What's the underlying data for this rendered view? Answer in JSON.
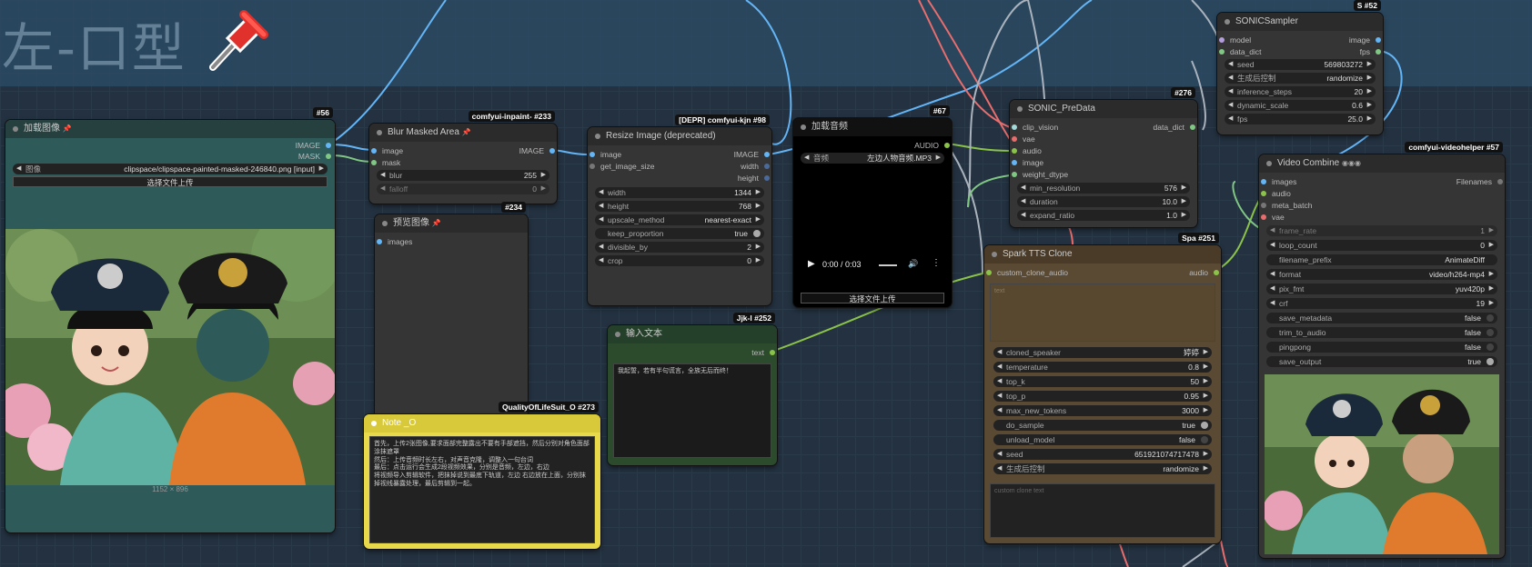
{
  "group_title": "左-口型",
  "colors": {
    "image": "#64b5f6",
    "mask": "#81c784",
    "audio": "#8bc34a",
    "string": "#77dd77",
    "wire_red": "#e96d6d",
    "wire_gray": "#aab3bd"
  },
  "nodes": {
    "load_image": {
      "badge": "#56",
      "title": "加载图像",
      "out_image": "IMAGE",
      "out_mask": "MASK",
      "w_image_label": "图像",
      "w_image_value": "clipspace/clipspace-painted-masked-246840.png [input]",
      "upload": "选择文件上传",
      "size": "1152 × 896"
    },
    "blur": {
      "badge": "comfyui-inpaint-  #233",
      "title": "Blur Masked Area",
      "in1": "image",
      "in2": "mask",
      "out": "IMAGE",
      "w1_l": "blur",
      "w1_v": "255",
      "w2_l": "falloff",
      "w2_v": "0"
    },
    "preview": {
      "badge": "#234",
      "title": "预览图像",
      "in1": "images"
    },
    "resize": {
      "badge": "[DEPR] comfyui-kjn  #98",
      "title": "Resize Image (deprecated)",
      "in1": "image",
      "in2": "get_image_size",
      "out1": "IMAGE",
      "out2": "width",
      "out3": "height",
      "widgets": [
        {
          "l": "width",
          "v": "1344"
        },
        {
          "l": "height",
          "v": "768"
        },
        {
          "l": "upscale_method",
          "v": "nearest-exact"
        },
        {
          "l": "keep_proportion",
          "v": "true"
        },
        {
          "l": "divisible_by",
          "v": "2"
        },
        {
          "l": "crop",
          "v": "0"
        }
      ]
    },
    "audio_load": {
      "badge": "#67",
      "title": "加载音频",
      "out": "AUDIO",
      "w_l": "音频",
      "w_v": "左边人物音频.MP3",
      "time": "0:00 / 0:03",
      "upload": "选择文件上传"
    },
    "text_input": {
      "badge": "Jjk-l  #252",
      "title": "输入文本",
      "out": "text",
      "value": "我起誓，若有半句谎言，全族无后而终！"
    },
    "note": {
      "badge": "QualityOfLifeSuit_O  #273",
      "title": "Note _O",
      "value": "首先，上传2张图像,要求面部完整露出不要有手部遮挡，然后分别对角色面部涂抹遮罩\n然后：上传音频时长左右，对声音克隆，调整入一句台词\n最后：点击运行会生成2段视频效果，分别是音频，左边，右边\n将视频导入剪辑软件，把抹掉说到最底下轨道，左边 右边放在上面，分别抹掉视线暴露处理，最后剪辑到一起。"
    },
    "predata": {
      "badge": "#276",
      "title": "SONIC_PreData",
      "in": [
        "clip_vision",
        "vae",
        "audio",
        "image",
        "weight_dtype"
      ],
      "out": "data_dict",
      "widgets": [
        {
          "l": "min_resolution",
          "v": "576"
        },
        {
          "l": "duration",
          "v": "10.0"
        },
        {
          "l": "expand_ratio",
          "v": "1.0"
        }
      ]
    },
    "sampler": {
      "badge": "S  #52",
      "title": "SONICSampler",
      "in1": "model",
      "in2": "data_dict",
      "out1": "image",
      "out2": "fps",
      "widgets": [
        {
          "l": "seed",
          "v": "569803272"
        },
        {
          "l": "生成后控制",
          "v": "randomize"
        },
        {
          "l": "inference_steps",
          "v": "20"
        },
        {
          "l": "dynamic_scale",
          "v": "0.6"
        },
        {
          "l": "fps",
          "v": "25.0"
        }
      ]
    },
    "tts": {
      "badge": "Spa  #251",
      "title": "Spark TTS Clone",
      "in": "custom_clone_audio",
      "out": "audio",
      "placeholder1": "text",
      "placeholder2": "custom clone text",
      "widgets": [
        {
          "l": "cloned_speaker",
          "v": "婷婷"
        },
        {
          "l": "temperature",
          "v": "0.8"
        },
        {
          "l": "top_k",
          "v": "50"
        },
        {
          "l": "top_p",
          "v": "0.95"
        },
        {
          "l": "max_new_tokens",
          "v": "3000"
        },
        {
          "l": "do_sample",
          "v": "true"
        },
        {
          "l": "unload_model",
          "v": "false"
        },
        {
          "l": "seed",
          "v": "651921074717478"
        },
        {
          "l": "生成后控制",
          "v": "randomize"
        }
      ]
    },
    "combine": {
      "badge": "comfyui-videohelper  #57",
      "title": "Video Combine",
      "in": [
        "images",
        "audio",
        "meta_batch",
        "vae"
      ],
      "out": "Filenames",
      "widgets": [
        {
          "l": "frame_rate",
          "v": "1"
        },
        {
          "l": "loop_count",
          "v": "0"
        },
        {
          "l": "filename_prefix",
          "v": "AnimateDiff"
        },
        {
          "l": "format",
          "v": "video/h264-mp4"
        },
        {
          "l": "pix_fmt",
          "v": "yuv420p"
        },
        {
          "l": "crf",
          "v": "19"
        },
        {
          "l": "save_metadata",
          "v": "false"
        },
        {
          "l": "trim_to_audio",
          "v": "false"
        },
        {
          "l": "pingpong",
          "v": "false"
        },
        {
          "l": "save_output",
          "v": "true"
        }
      ]
    }
  }
}
